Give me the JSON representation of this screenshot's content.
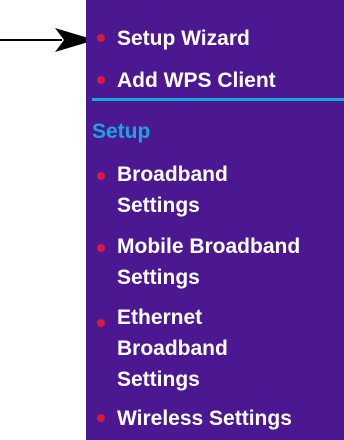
{
  "annotation": {
    "pointer_icon": "right-arrow-icon"
  },
  "sidebar": {
    "background_color": "#4b1892",
    "bullet_color": "#d91a3f",
    "accent_color": "#1aa5df",
    "items_top": [
      {
        "label": "Setup Wizard"
      },
      {
        "label": "Add WPS Client"
      }
    ],
    "section_heading": "Setup",
    "setup_items": [
      {
        "lines": [
          "Broadband",
          "Settings"
        ]
      },
      {
        "lines": [
          "Mobile Broadband",
          "Settings"
        ]
      },
      {
        "lines": [
          "Ethernet",
          "Broadband",
          "Settings"
        ]
      },
      {
        "lines": [
          "Wireless Settings"
        ]
      }
    ]
  }
}
